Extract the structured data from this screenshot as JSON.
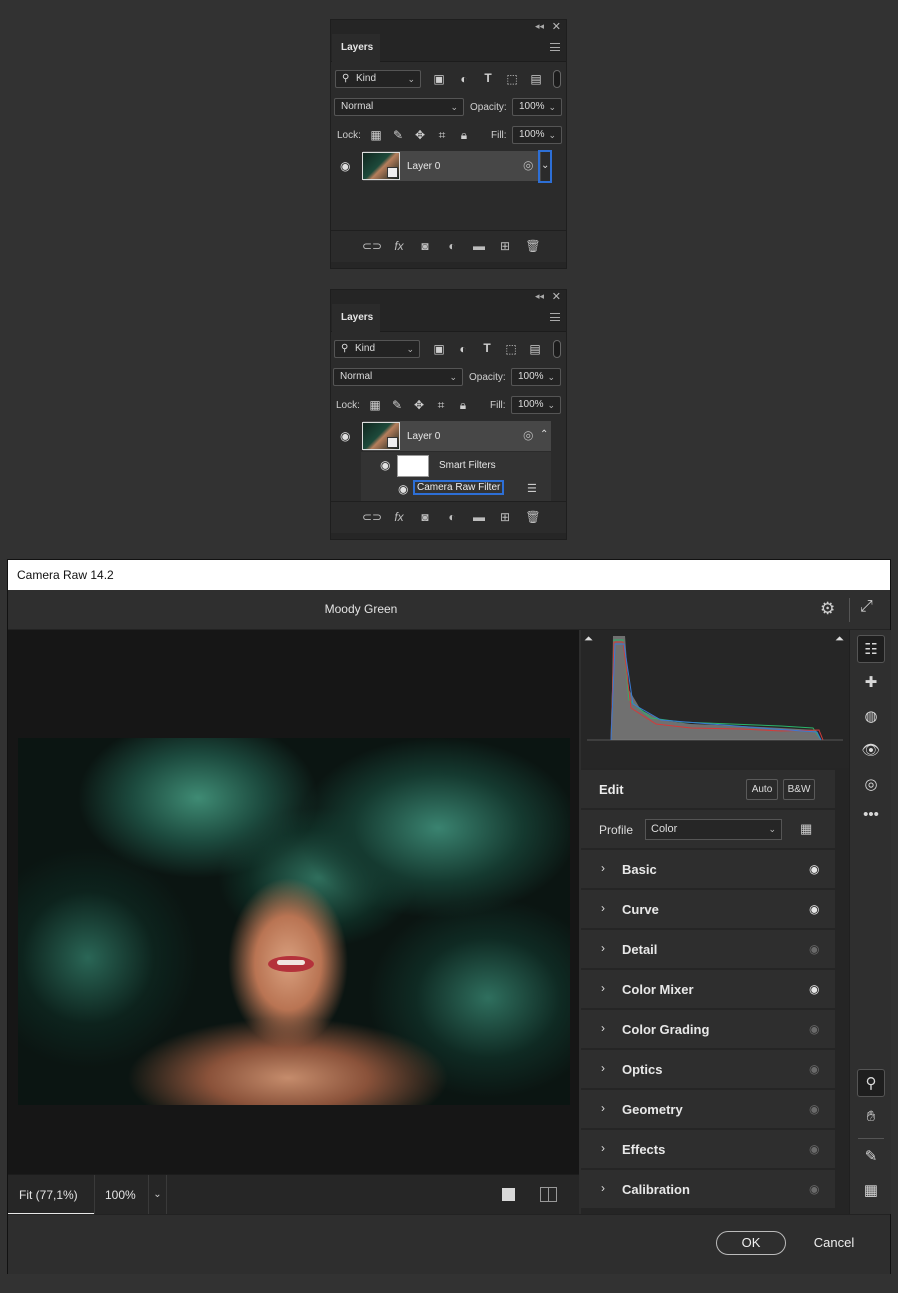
{
  "panel1": {
    "tab": "Layers",
    "filter": "Kind",
    "blend_mode": "Normal",
    "opacity_label": "Opacity:",
    "opacity": "100%",
    "lock_label": "Lock:",
    "fill_label": "Fill:",
    "fill": "100%",
    "layer_name": "Layer 0"
  },
  "panel2": {
    "tab": "Layers",
    "filter": "Kind",
    "blend_mode": "Normal",
    "opacity_label": "Opacity:",
    "opacity": "100%",
    "lock_label": "Lock:",
    "fill_label": "Fill:",
    "fill": "100%",
    "layer_name": "Layer 0",
    "smart_filters": "Smart Filters",
    "filter_name": "Camera Raw Filter"
  },
  "camera_raw": {
    "window_title": "Camera Raw 14.2",
    "preset_title": "Moody Green",
    "zoom_fit": "Fit (77,1%)",
    "zoom_pct": "100%",
    "edit_label": "Edit",
    "auto_label": "Auto",
    "bw_label": "B&W",
    "profile_label": "Profile",
    "profile_value": "Color",
    "sections": [
      {
        "name": "Basic",
        "visible": true
      },
      {
        "name": "Curve",
        "visible": true
      },
      {
        "name": "Detail",
        "visible": false
      },
      {
        "name": "Color Mixer",
        "visible": true
      },
      {
        "name": "Color Grading",
        "visible": false
      },
      {
        "name": "Optics",
        "visible": false
      },
      {
        "name": "Geometry",
        "visible": false
      },
      {
        "name": "Effects",
        "visible": false
      },
      {
        "name": "Calibration",
        "visible": false
      }
    ],
    "ok_label": "OK",
    "cancel_label": "Cancel",
    "colors": {
      "eye_on": "#e6e6e6",
      "eye_off": "#6a6a6a",
      "selection": "#2d6fd6"
    }
  }
}
